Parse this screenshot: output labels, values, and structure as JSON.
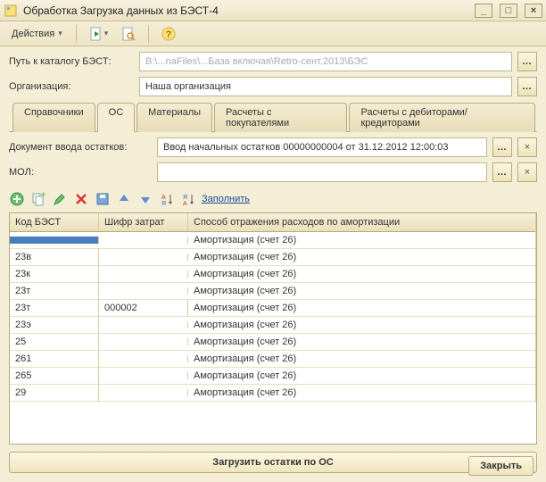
{
  "window": {
    "title": "Обработка  Загрузка данных из БЭСТ-4"
  },
  "toolbar": {
    "actions_label": "Действия"
  },
  "fields": {
    "path_label": "Путь к каталогу БЭСТ:",
    "path_value": "B:\\...naFiles\\...База включая\\Retro-сент.2013\\БЭС",
    "org_label": "Организация:",
    "org_value": "Наша организация",
    "doc_label": "Документ ввода остатков:",
    "doc_value": "Ввод начальных остатков 00000000004 от 31.12.2012 12:00:03",
    "mol_label": "МОЛ:",
    "mol_value": ""
  },
  "tabs": [
    {
      "label": "Справочники",
      "active": false
    },
    {
      "label": "ОС",
      "active": true
    },
    {
      "label": "Материалы",
      "active": false
    },
    {
      "label": "Расчеты с покупателями",
      "active": false
    },
    {
      "label": "Расчеты с дебиторами/кредиторами",
      "active": false
    }
  ],
  "grid_toolbar": {
    "fill_label": "Заполнить"
  },
  "grid": {
    "headers": {
      "c1": "Код БЭСТ",
      "c2": "Шифр затрат",
      "c3": "Способ отражения расходов по амортизации"
    },
    "rows": [
      {
        "c1": "",
        "c2": "",
        "c3": "Амортизация (счет 26)",
        "selected": true
      },
      {
        "c1": "23в",
        "c2": "",
        "c3": "Амортизация (счет 26)"
      },
      {
        "c1": "23к",
        "c2": "",
        "c3": "Амортизация (счет 26)"
      },
      {
        "c1": "23т",
        "c2": "",
        "c3": "Амортизация (счет 26)"
      },
      {
        "c1": "23т",
        "c2": "000002",
        "c3": "Амортизация (счет 26)"
      },
      {
        "c1": "23э",
        "c2": "",
        "c3": "Амортизация (счет 26)"
      },
      {
        "c1": "25",
        "c2": "",
        "c3": "Амортизация (счет 26)"
      },
      {
        "c1": "261",
        "c2": "",
        "c3": "Амортизация (счет 26)"
      },
      {
        "c1": "265",
        "c2": "",
        "c3": "Амортизация (счет 26)"
      },
      {
        "c1": "29",
        "c2": "",
        "c3": "Амортизация (счет 26)"
      }
    ]
  },
  "buttons": {
    "load_label": "Загрузить остатки по ОС",
    "close_label": "Закрыть"
  }
}
